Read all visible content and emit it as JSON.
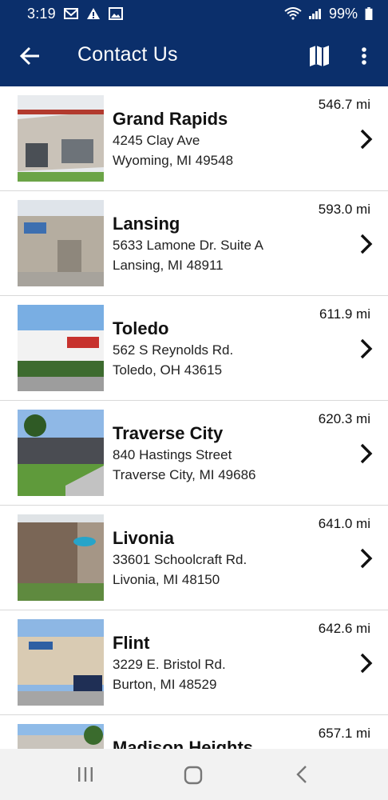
{
  "status_bar": {
    "time": "3:19",
    "battery": "99%",
    "left_icons": [
      "gmail-icon",
      "warning-icon",
      "image-icon"
    ],
    "right_icons": [
      "wifi-icon",
      "signal-icon",
      "battery-icon"
    ]
  },
  "app_bar": {
    "title": "Contact Us",
    "back_icon": "arrow-left-icon",
    "map_icon": "map-icon",
    "more_icon": "more-vertical-icon"
  },
  "colors": {
    "primary": "#0b2f6b",
    "divider": "#d9d9d9",
    "nav_bar": "#f2f2f2"
  },
  "locations": [
    {
      "name": "Grand Rapids",
      "street": "4245 Clay Ave",
      "city": "Wyoming, MI 49548",
      "distance": "546.7 mi"
    },
    {
      "name": "Lansing",
      "street": "5633 Lamone Dr. Suite A",
      "city": "Lansing, MI 48911",
      "distance": "593.0 mi"
    },
    {
      "name": "Toledo",
      "street": "562 S Reynolds Rd.",
      "city": "Toledo, OH 43615",
      "distance": "611.9 mi"
    },
    {
      "name": "Traverse City",
      "street": "840 Hastings Street",
      "city": "Traverse City, MI 49686",
      "distance": "620.3 mi"
    },
    {
      "name": "Livonia",
      "street": "33601 Schoolcraft Rd.",
      "city": "Livonia, MI 48150",
      "distance": "641.0 mi"
    },
    {
      "name": "Flint",
      "street": "3229 E. Bristol Rd.",
      "city": "Burton, MI 48529",
      "distance": "642.6 mi"
    },
    {
      "name": "Madison Heights",
      "street": "",
      "city": "",
      "distance": "657.1 mi"
    }
  ],
  "nav_bar": {
    "icons": [
      "recents-icon",
      "home-icon",
      "back-icon"
    ]
  }
}
